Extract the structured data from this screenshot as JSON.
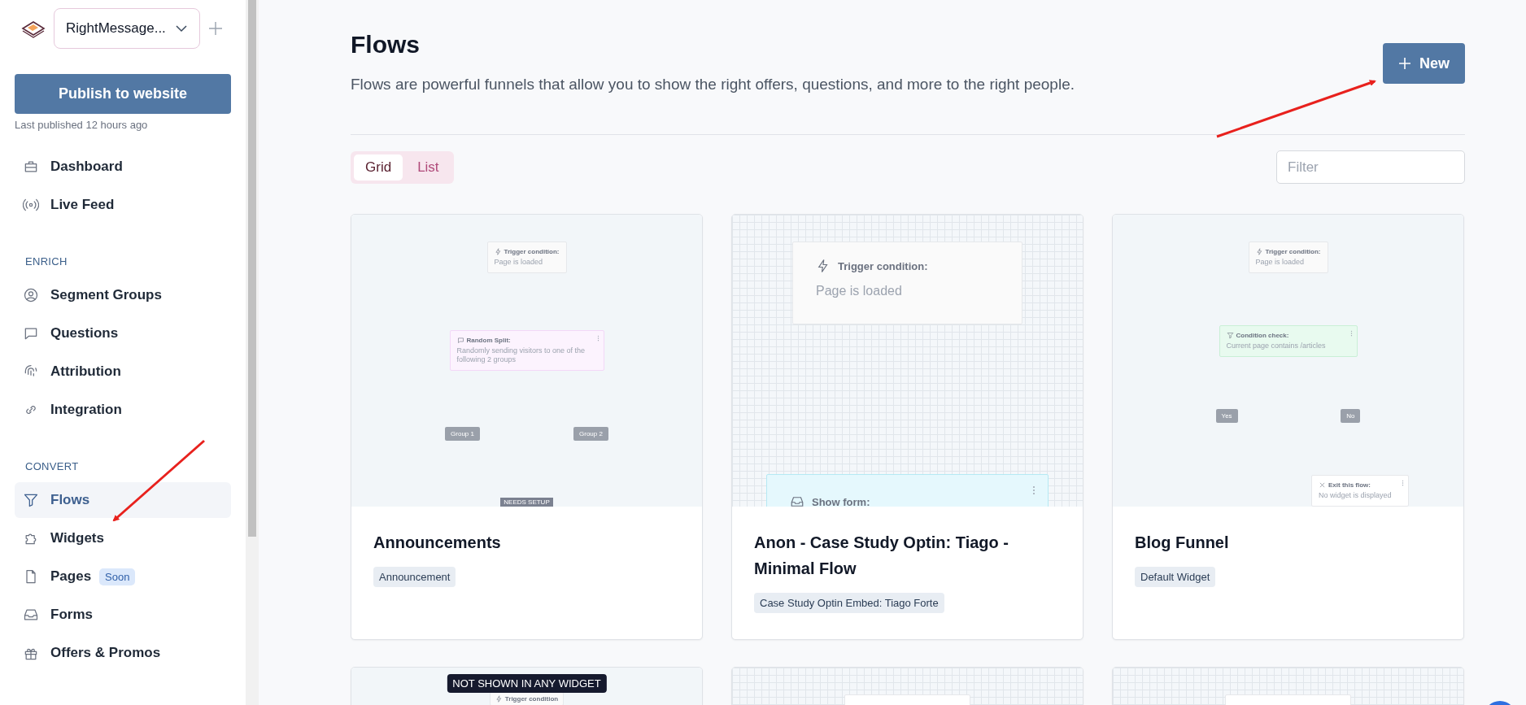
{
  "sidebar": {
    "account": {
      "value": "RightMessage..."
    },
    "publish_button": "Publish to website",
    "last_published": "Last published 12 hours ago",
    "sections": [
      {
        "items": [
          {
            "label": "Dashboard",
            "selected": false
          },
          {
            "label": "Live Feed",
            "selected": false
          }
        ]
      },
      {
        "heading": "ENRICH",
        "items": [
          {
            "label": "Segment Groups",
            "selected": false
          },
          {
            "label": "Questions",
            "selected": false
          },
          {
            "label": "Attribution",
            "selected": false
          },
          {
            "label": "Integration",
            "selected": false
          }
        ]
      },
      {
        "heading": "CONVERT",
        "items": [
          {
            "label": "Flows",
            "selected": true
          },
          {
            "label": "Widgets",
            "selected": false
          },
          {
            "label": "Pages",
            "selected": false,
            "badge": "Soon"
          },
          {
            "label": "Forms",
            "selected": false
          },
          {
            "label": "Offers & Promos",
            "selected": false
          }
        ]
      }
    ]
  },
  "page": {
    "title": "Flows",
    "subtitle": "Flows are powerful funnels that allow you to show the right offers, questions, and more to the right people.",
    "new_button": "New",
    "view_toggle": [
      {
        "label": "Grid",
        "selected": true
      },
      {
        "label": "List",
        "selected": false
      }
    ],
    "filter": {
      "placeholder": "Filter"
    },
    "cards": [
      {
        "title": "Announcements",
        "tag": "Announcement",
        "preview": {
          "zoomed": false,
          "rows": [
            [
              {
                "kind": "trigger",
                "title": "Trigger condition:",
                "text": "Page is loaded"
              }
            ],
            [
              {
                "kind": "split",
                "title": "Random Split:",
                "text": "Randomly sending visitors to one of the following 2 groups"
              }
            ],
            [
              {
                "kind": "group",
                "text": "Group 1"
              },
              {
                "kind": "group",
                "text": "Group 2"
              }
            ],
            [
              {
                "kind": "badge",
                "text": "NEEDS SETUP"
              }
            ]
          ]
        }
      },
      {
        "title": "Anon - Case Study Optin: Tiago - Minimal Flow",
        "tag": "Case Study Optin Embed: Tiago Forte",
        "preview": {
          "zoomed": true,
          "rows": [
            [
              {
                "kind": "trigger",
                "title": "Trigger condition:",
                "text": "Page is loaded"
              }
            ],
            [
              {
                "kind": "form",
                "title": "Show form:"
              }
            ]
          ]
        }
      },
      {
        "title": "Blog Funnel",
        "tag": "Default Widget",
        "preview": {
          "zoomed": false,
          "rows": [
            [
              {
                "kind": "trigger",
                "title": "Trigger condition:",
                "text": "Page is loaded"
              }
            ],
            [
              {
                "kind": "condition",
                "title": "Condition check:",
                "text": "Current page contains /articles"
              }
            ],
            [
              {
                "kind": "group",
                "text": "Yes"
              },
              {
                "kind": "group",
                "text": "No"
              }
            ],
            [
              {
                "kind": "spacer"
              },
              {
                "kind": "exit",
                "title": "Exit this flow:",
                "text": "No widget is displayed"
              }
            ]
          ]
        }
      },
      {
        "notice": "NOT SHOWN IN ANY WIDGET",
        "preview": {
          "zoomed": false,
          "rows": [
            [
              {
                "kind": "trigger",
                "title": "Trigger condition"
              }
            ]
          ]
        }
      },
      {
        "preview": {
          "zoomed": true,
          "rows": [
            [
              {
                "kind": "blank"
              }
            ]
          ]
        }
      },
      {
        "preview": {
          "zoomed": true,
          "rows": [
            [
              {
                "kind": "blank"
              }
            ]
          ]
        }
      }
    ]
  }
}
